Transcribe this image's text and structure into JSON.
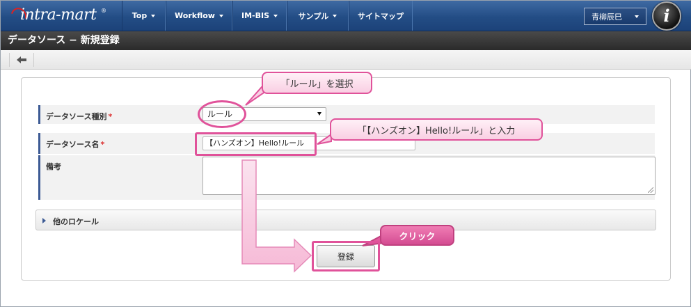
{
  "header": {
    "logo_text": "intra-mart",
    "logo_mark": "®",
    "nav": [
      {
        "label": "Top"
      },
      {
        "label": "Workflow"
      },
      {
        "label": "IM-BIS"
      },
      {
        "label": "サンプル"
      },
      {
        "label": "サイトマップ"
      }
    ],
    "user_name": "青柳辰巳",
    "help_icon_glyph": "i"
  },
  "page": {
    "title": "データソース − 新規登録"
  },
  "toolbar": {
    "back_icon": "back-arrow-icon"
  },
  "form": {
    "datasource_type": {
      "label": "データソース種別",
      "required_mark": "*",
      "selected": "ルール"
    },
    "datasource_name": {
      "label": "データソース名",
      "required_mark": "*",
      "value": "【ハンズオン】Hello!ルール"
    },
    "remarks": {
      "label": "備考",
      "value": ""
    },
    "other_locale": {
      "label": "他のロケール"
    },
    "submit_label": "登録"
  },
  "annotations": {
    "callout_select": "「ルール」を選択",
    "callout_input": "「【ハンズオン】Hello!ルール」と入力",
    "callout_click": "クリック"
  },
  "colors": {
    "nav_blue": "#234d85",
    "title_dark": "#2a2a2a",
    "annotation_pink": "#e0529a",
    "label_bar": "#3c5a94"
  }
}
